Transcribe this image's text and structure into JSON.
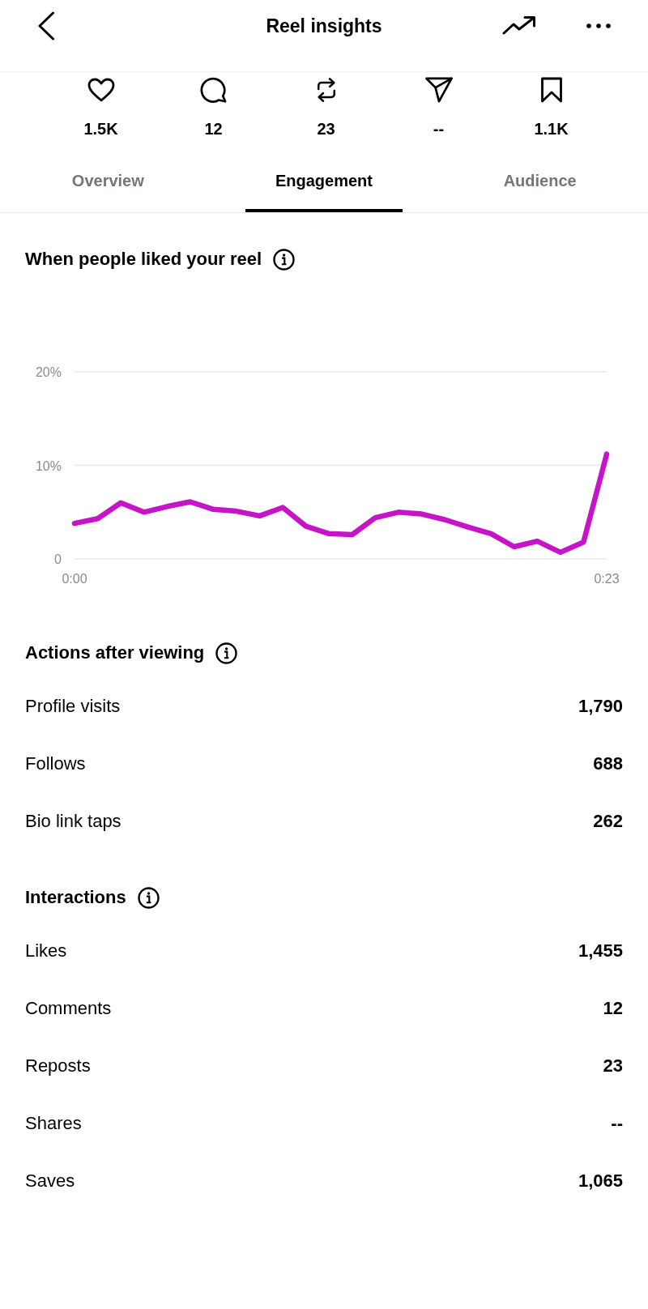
{
  "header": {
    "title": "Reel insights"
  },
  "stats": [
    {
      "kind": "like",
      "value": "1.5K"
    },
    {
      "kind": "comment",
      "value": "12"
    },
    {
      "kind": "repost",
      "value": "23"
    },
    {
      "kind": "share",
      "value": "--"
    },
    {
      "kind": "save",
      "value": "1.1K"
    }
  ],
  "tabs": [
    {
      "label": "Overview",
      "selected": false
    },
    {
      "label": "Engagement",
      "selected": true
    },
    {
      "label": "Audience",
      "selected": false
    }
  ],
  "liked_chart": {
    "chart_data": {
      "type": "line",
      "title": "When people liked your reel",
      "x": [
        0,
        1,
        2,
        3,
        4,
        5,
        6,
        7,
        8,
        9,
        10,
        11,
        12,
        13,
        14,
        15,
        16,
        17,
        18,
        19,
        20,
        21,
        22,
        23
      ],
      "series": [
        {
          "color": "#c614c9",
          "values": [
            3.8,
            4.3,
            6.0,
            5.0,
            5.6,
            6.1,
            5.3,
            5.1,
            4.6,
            5.5,
            3.5,
            2.7,
            2.6,
            4.4,
            5.0,
            4.8,
            4.2,
            3.4,
            2.7,
            1.3,
            1.9,
            0.7,
            1.8,
            11.2
          ]
        }
      ],
      "xlim": [
        0,
        23
      ],
      "ylim": [
        0,
        20
      ],
      "yticks": [
        {
          "value": 0,
          "label": "0"
        },
        {
          "value": 10,
          "label": "10%"
        },
        {
          "value": 20,
          "label": "20%"
        }
      ],
      "xticks": [
        {
          "value": 0,
          "label": "0:00"
        },
        {
          "value": 23,
          "label": "0:23"
        }
      ]
    }
  },
  "actions_after_viewing": {
    "title": "Actions after viewing",
    "rows": [
      {
        "label": "Profile visits",
        "value": "1,790"
      },
      {
        "label": "Follows",
        "value": "688"
      },
      {
        "label": "Bio link taps",
        "value": "262"
      }
    ]
  },
  "interactions": {
    "title": "Interactions",
    "rows": [
      {
        "label": "Likes",
        "value": "1,455"
      },
      {
        "label": "Comments",
        "value": "12"
      },
      {
        "label": "Reposts",
        "value": "23"
      },
      {
        "label": "Shares",
        "value": "--"
      },
      {
        "label": "Saves",
        "value": "1,065"
      }
    ]
  }
}
